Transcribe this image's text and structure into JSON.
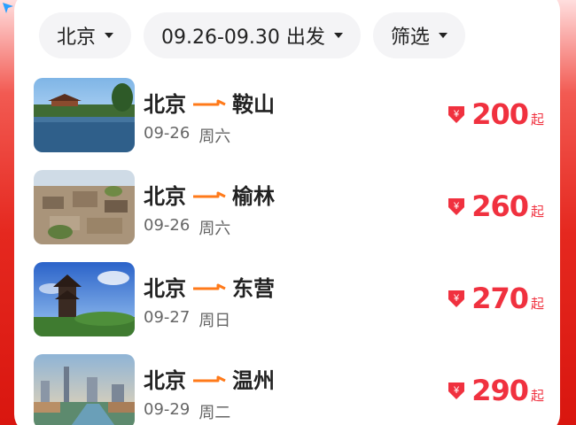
{
  "filters": [
    {
      "label": "北京"
    },
    {
      "label": "09.26-09.30 出发"
    },
    {
      "label": "筛选"
    }
  ],
  "routes": [
    {
      "from": "北京",
      "to": "鞍山",
      "date": "09-26",
      "weekday": "周六",
      "price": "200",
      "suffix": "起",
      "currency": "¥"
    },
    {
      "from": "北京",
      "to": "榆林",
      "date": "09-26",
      "weekday": "周六",
      "price": "260",
      "suffix": "起",
      "currency": "¥"
    },
    {
      "from": "北京",
      "to": "东营",
      "date": "09-27",
      "weekday": "周日",
      "price": "270",
      "suffix": "起",
      "currency": "¥"
    },
    {
      "from": "北京",
      "to": "温州",
      "date": "09-29",
      "weekday": "周二",
      "price": "290",
      "suffix": "起",
      "currency": "¥"
    }
  ],
  "colors": {
    "accent_price": "#f0313f",
    "route_arrow": "#ff7a1a",
    "background_red": "#e5281f"
  },
  "icons": {
    "corner": "navigation-arrow-icon",
    "dropdown": "caret-down-icon",
    "route": "route-arrow-icon",
    "price": "price-tag-icon"
  }
}
